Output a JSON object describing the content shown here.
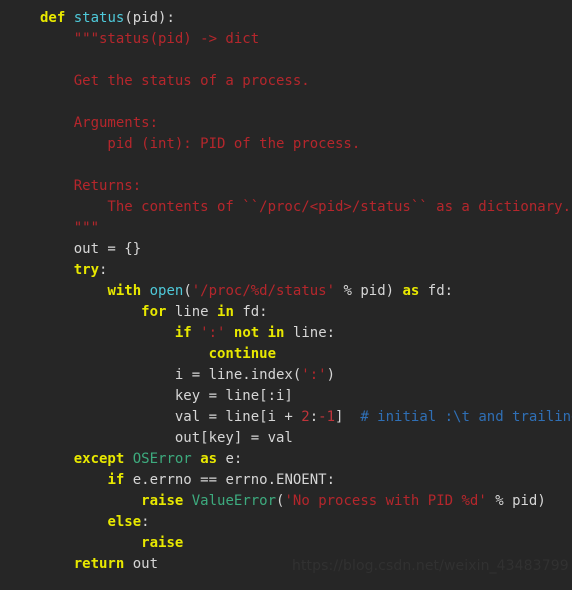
{
  "editor": {
    "background_color": "#262626",
    "language": "python",
    "colors": {
      "keyword": "#e8e800",
      "function": "#4ec9d9",
      "builtin": "#4ec9d9",
      "exception": "#3dab7e",
      "string": "#b5262c",
      "docstring": "#b5262c",
      "number": "#c0343a",
      "comment": "#2f6fb5",
      "plain": "#d6d6d6",
      "watermark": "#313131"
    }
  },
  "watermark": {
    "text": "https://blog.csdn.net/weixin_43483799"
  },
  "code": {
    "lines": [
      {
        "n": 1,
        "tokens": [
          {
            "t": "def",
            "c": "kw"
          },
          {
            "t": " ",
            "c": "pl"
          },
          {
            "t": "status",
            "c": "fn"
          },
          {
            "t": "(pid):",
            "c": "pl"
          }
        ]
      },
      {
        "n": 2,
        "tokens": [
          {
            "t": "    \"\"\"status(pid) -> dict",
            "c": "doc"
          }
        ]
      },
      {
        "n": 3,
        "tokens": [
          {
            "t": "",
            "c": "pl"
          }
        ]
      },
      {
        "n": 4,
        "tokens": [
          {
            "t": "    Get the status of a process.",
            "c": "doc"
          }
        ]
      },
      {
        "n": 5,
        "tokens": [
          {
            "t": "",
            "c": "pl"
          }
        ]
      },
      {
        "n": 6,
        "tokens": [
          {
            "t": "    Arguments:",
            "c": "doc"
          }
        ]
      },
      {
        "n": 7,
        "tokens": [
          {
            "t": "        pid (int): PID of the process.",
            "c": "doc"
          }
        ]
      },
      {
        "n": 8,
        "tokens": [
          {
            "t": "",
            "c": "pl"
          }
        ]
      },
      {
        "n": 9,
        "tokens": [
          {
            "t": "    Returns:",
            "c": "doc"
          }
        ]
      },
      {
        "n": 10,
        "tokens": [
          {
            "t": "        The contents of ``/proc/<pid>/status`` as a dictionary.",
            "c": "doc"
          }
        ]
      },
      {
        "n": 11,
        "tokens": [
          {
            "t": "    \"\"\"",
            "c": "doc"
          }
        ]
      },
      {
        "n": 12,
        "tokens": [
          {
            "t": "    out = {}",
            "c": "pl"
          }
        ]
      },
      {
        "n": 13,
        "tokens": [
          {
            "t": "    ",
            "c": "pl"
          },
          {
            "t": "try",
            "c": "kw"
          },
          {
            "t": ":",
            "c": "pl"
          }
        ]
      },
      {
        "n": 14,
        "tokens": [
          {
            "t": "        ",
            "c": "pl"
          },
          {
            "t": "with",
            "c": "kw"
          },
          {
            "t": " ",
            "c": "pl"
          },
          {
            "t": "open",
            "c": "bi"
          },
          {
            "t": "(",
            "c": "pl"
          },
          {
            "t": "'/proc/%d/status'",
            "c": "str"
          },
          {
            "t": " % pid) ",
            "c": "pl"
          },
          {
            "t": "as",
            "c": "kw"
          },
          {
            "t": " fd:",
            "c": "pl"
          }
        ]
      },
      {
        "n": 15,
        "tokens": [
          {
            "t": "            ",
            "c": "pl"
          },
          {
            "t": "for",
            "c": "kw"
          },
          {
            "t": " line ",
            "c": "pl"
          },
          {
            "t": "in",
            "c": "kw"
          },
          {
            "t": " fd:",
            "c": "pl"
          }
        ]
      },
      {
        "n": 16,
        "tokens": [
          {
            "t": "                ",
            "c": "pl"
          },
          {
            "t": "if",
            "c": "kw"
          },
          {
            "t": " ",
            "c": "pl"
          },
          {
            "t": "':'",
            "c": "str"
          },
          {
            "t": " ",
            "c": "pl"
          },
          {
            "t": "not",
            "c": "kw"
          },
          {
            "t": " ",
            "c": "pl"
          },
          {
            "t": "in",
            "c": "kw"
          },
          {
            "t": " line:",
            "c": "pl"
          }
        ]
      },
      {
        "n": 17,
        "tokens": [
          {
            "t": "                    ",
            "c": "pl"
          },
          {
            "t": "continue",
            "c": "kw"
          }
        ]
      },
      {
        "n": 18,
        "tokens": [
          {
            "t": "                i = line.index(",
            "c": "pl"
          },
          {
            "t": "':'",
            "c": "str"
          },
          {
            "t": ")",
            "c": "pl"
          }
        ]
      },
      {
        "n": 19,
        "tokens": [
          {
            "t": "                key = line[:i]",
            "c": "pl"
          }
        ]
      },
      {
        "n": 20,
        "tokens": [
          {
            "t": "                val = line[i + ",
            "c": "pl"
          },
          {
            "t": "2",
            "c": "num"
          },
          {
            "t": ":",
            "c": "pl"
          },
          {
            "t": "-1",
            "c": "num"
          },
          {
            "t": "]  ",
            "c": "pl"
          },
          {
            "t": "# initial :\\t and trailing \\n",
            "c": "com"
          }
        ]
      },
      {
        "n": 21,
        "tokens": [
          {
            "t": "                out[key] = val",
            "c": "pl"
          }
        ]
      },
      {
        "n": 22,
        "tokens": [
          {
            "t": "    ",
            "c": "pl"
          },
          {
            "t": "except",
            "c": "kw"
          },
          {
            "t": " ",
            "c": "pl"
          },
          {
            "t": "OSError",
            "c": "exc"
          },
          {
            "t": " ",
            "c": "pl"
          },
          {
            "t": "as",
            "c": "kw"
          },
          {
            "t": " e:",
            "c": "pl"
          }
        ]
      },
      {
        "n": 23,
        "tokens": [
          {
            "t": "        ",
            "c": "pl"
          },
          {
            "t": "if",
            "c": "kw"
          },
          {
            "t": " e.errno == errno.ENOENT:",
            "c": "pl"
          }
        ]
      },
      {
        "n": 24,
        "tokens": [
          {
            "t": "            ",
            "c": "pl"
          },
          {
            "t": "raise",
            "c": "kw"
          },
          {
            "t": " ",
            "c": "pl"
          },
          {
            "t": "ValueError",
            "c": "exc"
          },
          {
            "t": "(",
            "c": "pl"
          },
          {
            "t": "'No process with PID %d'",
            "c": "str"
          },
          {
            "t": " % pid)",
            "c": "pl"
          }
        ]
      },
      {
        "n": 25,
        "tokens": [
          {
            "t": "        ",
            "c": "pl"
          },
          {
            "t": "else",
            "c": "kw"
          },
          {
            "t": ":",
            "c": "pl"
          }
        ]
      },
      {
        "n": 26,
        "tokens": [
          {
            "t": "            ",
            "c": "pl"
          },
          {
            "t": "raise",
            "c": "kw"
          }
        ]
      },
      {
        "n": 27,
        "tokens": [
          {
            "t": "    ",
            "c": "pl"
          },
          {
            "t": "return",
            "c": "kw"
          },
          {
            "t": " out",
            "c": "pl"
          }
        ]
      }
    ]
  }
}
